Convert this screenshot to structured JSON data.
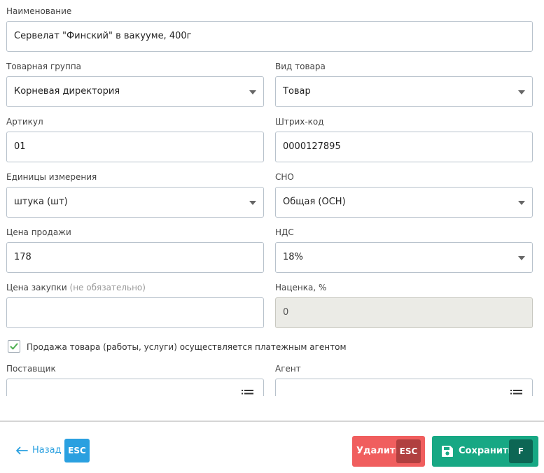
{
  "form": {
    "name": {
      "label": "Наименование",
      "value": "Сервелат \"Финский\" в вакууме, 400г"
    },
    "group": {
      "label": "Товарная группа",
      "value": "Корневая директория"
    },
    "kind": {
      "label": "Вид товара",
      "value": "Товар"
    },
    "article": {
      "label": "Артикул",
      "value": "01"
    },
    "barcode": {
      "label": "Штрих-код",
      "value": "0000127895"
    },
    "units": {
      "label": "Единицы измерения",
      "value": "штука (шт)"
    },
    "tax_system": {
      "label": "СНО",
      "value": "Общая (ОСН)"
    },
    "sale_price": {
      "label": "Цена продажи",
      "value": "178"
    },
    "vat": {
      "label": "НДС",
      "value": "18%"
    },
    "purchase_price": {
      "label": "Цена закупки",
      "optional_note": "(не обязательно)",
      "value": ""
    },
    "markup": {
      "label": "Наценка, %",
      "value": "0"
    },
    "payment_agent": {
      "label": "Продажа товара (работы, услуги) осуществляется платежным агентом",
      "checked": true
    },
    "supplier": {
      "label": "Поставщик",
      "value": ""
    },
    "agent": {
      "label": "Агент",
      "value": ""
    }
  },
  "footer": {
    "back_label": "Назад",
    "back_key": "ESC",
    "delete_label": "Удалить",
    "delete_key": "ESC",
    "save_label": "Сохранить",
    "save_key": "F"
  },
  "colors": {
    "accent_blue": "#2aa0e0",
    "delete_red": "#f05e5e",
    "save_green": "#17a884",
    "check_green": "#4caf50"
  }
}
